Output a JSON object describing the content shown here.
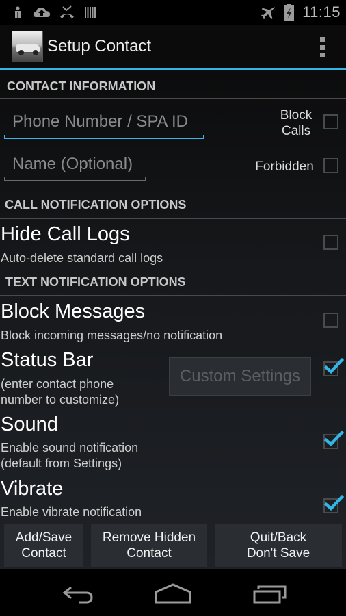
{
  "status_bar": {
    "left_icons": [
      "person-icon",
      "cloud-upload-icon",
      "missed-call-icon",
      "barcode-icon"
    ],
    "right_icons": [
      "airplane-mode-icon",
      "battery-charging-icon"
    ],
    "time": "11:15"
  },
  "action_bar": {
    "title": "Setup Contact",
    "app_icon": "car-image-icon",
    "overflow_icon": "overflow-menu-icon"
  },
  "accent_color": "#33b5e5",
  "contact_information": {
    "header": "CONTACT INFORMATION",
    "phone_field": {
      "value": "",
      "placeholder": "Phone Number / SPA ID",
      "focused": true
    },
    "name_field": {
      "value": "",
      "placeholder": "Name (Optional)"
    },
    "block_calls": {
      "label_line1": "Block",
      "label_line2": "Calls",
      "checked": false
    },
    "forbidden": {
      "label": "Forbidden",
      "checked": false
    }
  },
  "call_notification": {
    "header": "CALL NOTIFICATION OPTIONS",
    "hide_call_logs": {
      "title": "Hide Call Logs",
      "subtitle": "Auto-delete standard call logs",
      "checked": false
    }
  },
  "text_notification": {
    "header": "TEXT NOTIFICATION OPTIONS",
    "block_messages": {
      "title": "Block Messages",
      "subtitle": "Block incoming messages/no notification",
      "checked": false
    },
    "status_bar_option": {
      "title": "Status Bar",
      "subtitle_line1": "(enter contact phone",
      "subtitle_line2": "number to customize)",
      "custom_button": "Custom Settings",
      "custom_button_enabled": false,
      "checked": true
    },
    "sound": {
      "title": "Sound",
      "subtitle_line1": "Enable sound notification",
      "subtitle_line2": "(default from Settings)",
      "checked": true
    },
    "vibrate": {
      "title": "Vibrate",
      "subtitle": "Enable vibrate notification",
      "checked": true
    }
  },
  "buttons": {
    "add_save": {
      "line1": "Add/Save",
      "line2": "Contact"
    },
    "remove_hidden": {
      "line1": "Remove Hidden",
      "line2": "Contact"
    },
    "quit_back": {
      "line1": "Quit/Back",
      "line2": "Don't Save"
    }
  },
  "nav_bar": {
    "back": "back-icon",
    "home": "home-icon",
    "recents": "recent-apps-icon"
  }
}
